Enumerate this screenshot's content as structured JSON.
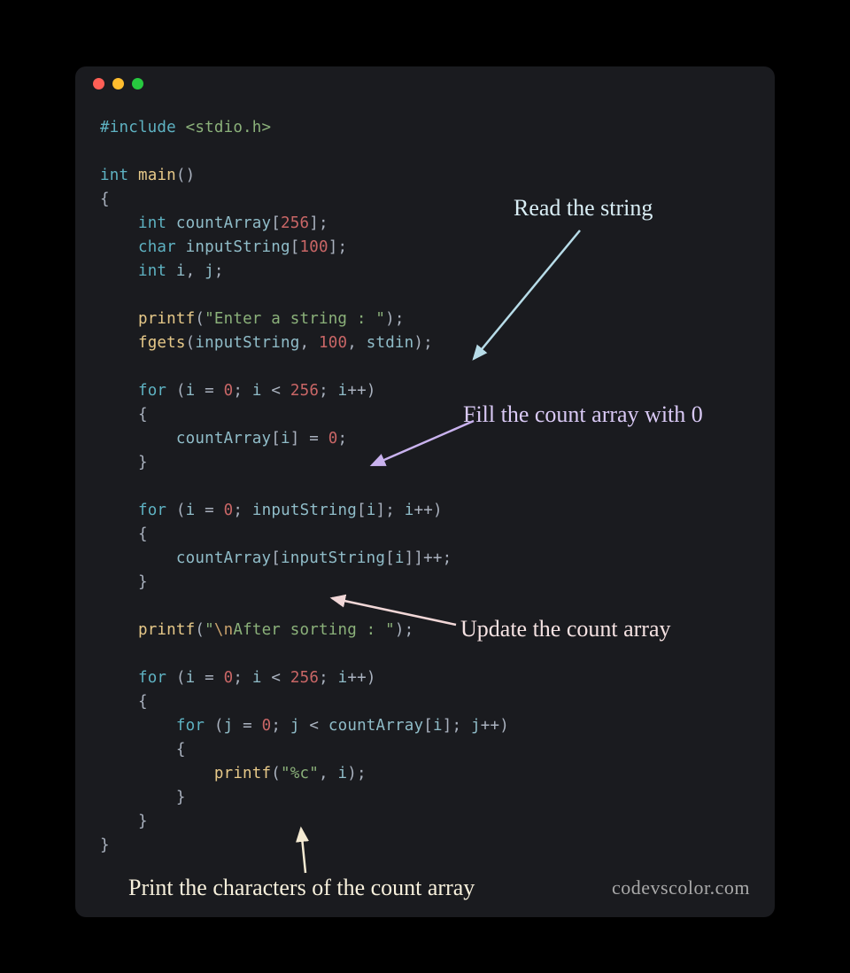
{
  "window": {
    "dots": [
      "red",
      "yellow",
      "green"
    ]
  },
  "code": {
    "line1_include": "#include",
    "line1_header": "<stdio.h>",
    "kw_int": "int",
    "kw_char": "char",
    "kw_for": "for",
    "fn_main": "main",
    "fn_printf": "printf",
    "fn_fgets": "fgets",
    "id_countArray": "countArray",
    "id_inputString": "inputString",
    "id_i": "i",
    "id_j": "j",
    "id_stdin": "stdin",
    "num_256": "256",
    "num_100": "100",
    "num_0": "0",
    "str_enter": "\"Enter a string : \"",
    "str_after_open": "\"",
    "str_after_esc": "\\n",
    "str_after_rest": "After sorting : \"",
    "str_fmt": "\"%c\""
  },
  "annotations": {
    "read": "Read the string",
    "fill": "Fill the count array with 0",
    "update": "Update the count array",
    "print": "Print the characters of the count array"
  },
  "watermark": "codevscolor.com"
}
